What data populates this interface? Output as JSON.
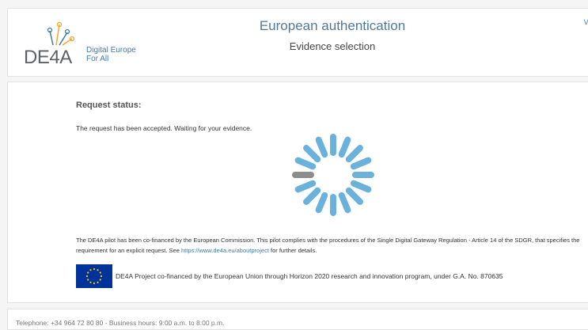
{
  "header": {
    "logo_text": "DE4A",
    "logo_tag_line1": "Digital Europe",
    "logo_tag_line2": "For All",
    "title": "European authentication",
    "subtitle": "Evidence selection",
    "corner_link": "Va"
  },
  "main": {
    "status_title": "Request status:",
    "status_text": "The request has been accepted. Waiting for your evidence.",
    "legal_text_before": "The DE4A pilot has been co-financed by the European Commission. This pilot complies with the procedures of the Single Digital Gateway Regulation - Article 14 of the SDGR, that specifies the requirement for an explicit request. See ",
    "legal_link": "https://www.de4a.eu/aboutproject",
    "legal_text_after": " for further details.",
    "eu_text": "DE4A Project co-financed by the European Union through Horizon 2020 research and innovation program, under G.A. No. 870635"
  },
  "spinner": {
    "segments": 16,
    "active_color": "#6ab1dc",
    "inactive_color": "#8d8d8d",
    "inactive_index": 12
  },
  "colors": {
    "brand_blue": "#3d7ca8",
    "eu_blue": "#003399",
    "eu_star": "#ffcc00"
  },
  "footer": {
    "text": "Telephone: +34 964 72 80 80 - Business hours: 9:00 a.m. to 8:00 p.m."
  }
}
